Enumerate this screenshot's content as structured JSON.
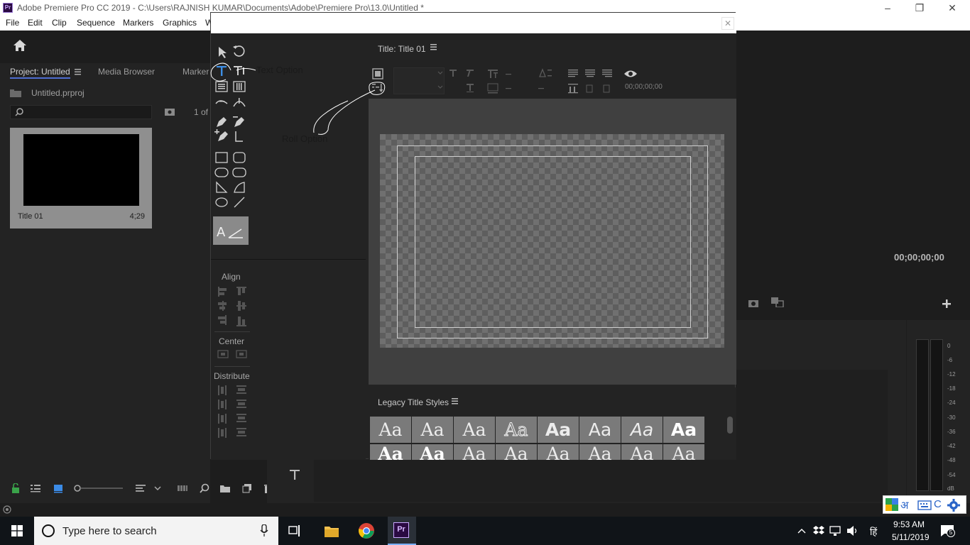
{
  "window": {
    "app_logo": "Pr",
    "title": "Adobe Premiere Pro CC 2019 - C:\\Users\\RAJNISH KUMAR\\Documents\\Adobe\\Premiere Pro\\13.0\\Untitled *"
  },
  "menu": {
    "items": [
      "File",
      "Edit",
      "Clip",
      "Sequence",
      "Markers",
      "Graphics",
      "W"
    ]
  },
  "project_panel": {
    "tabs": [
      "Project: Untitled",
      "Media Browser",
      "Marker"
    ],
    "file_name": "Untitled.prproj",
    "count": "1 of",
    "clip": {
      "name": "Title 01",
      "duration": "4;29"
    }
  },
  "program_monitor": {
    "timecode": "00;00;00;00"
  },
  "audio_meter": {
    "labels": [
      "0",
      "-6",
      "-12",
      "-18",
      "-24",
      "-30",
      "-36",
      "-42",
      "-48",
      "-54",
      "dB"
    ]
  },
  "title_window": {
    "designer_title": "Title: Title 01",
    "timecode_readout": "00;00;00;00",
    "align_label": "Align",
    "center_label": "Center",
    "distribute_label": "Distribute",
    "styles_title": "Legacy Title Styles",
    "style_swatches": [
      "Aa",
      "Aa",
      "Aa",
      "Aa",
      "Aa",
      "Aa",
      "Aa",
      "Aa"
    ],
    "style_swatches_row2": [
      "Aa",
      "Aa",
      "Aa",
      "Aa",
      "Aa",
      "Aa",
      "Aa",
      "Aa"
    ],
    "thumb_label": "A"
  },
  "annotations": {
    "text_option": "Text Option",
    "roll_option": "Roll Option"
  },
  "taskbar": {
    "search_placeholder": "Type here to search",
    "time": "9:53 AM",
    "date": "5/11/2019",
    "ime_lang": "हिं",
    "notifications": "5"
  },
  "ime_bar": {
    "script_char": "अ",
    "c_label": "C"
  },
  "colors": {
    "accent": "#4f6ed0",
    "premiere_purple": "#2a0a42",
    "taskbar": "#101418"
  }
}
